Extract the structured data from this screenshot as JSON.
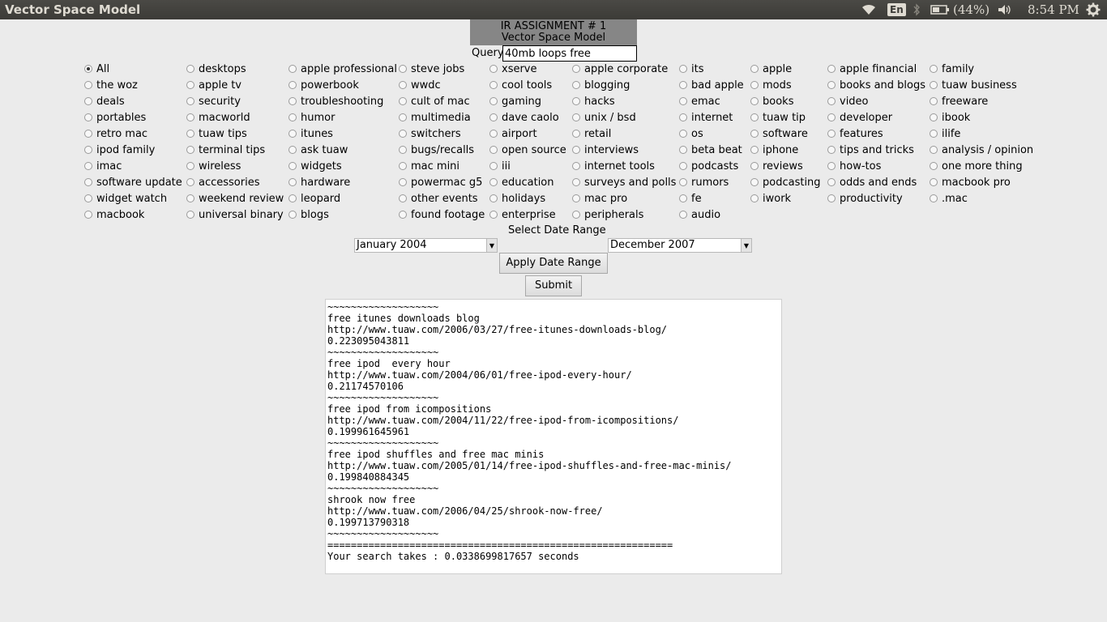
{
  "window": {
    "title": "Vector Space Model"
  },
  "tray": {
    "language": "En",
    "battery": "(44%)",
    "time": "8:54 PM"
  },
  "header": {
    "line1": "IR ASSIGNMENT # 1",
    "line2": "Vector Space Model"
  },
  "query": {
    "label": "Query",
    "value": "40mb loops free"
  },
  "categories": [
    [
      "All",
      "the woz",
      "deals",
      "portables",
      "retro mac",
      "ipod family",
      "imac",
      "software update",
      "widget watch",
      "macbook"
    ],
    [
      "desktops",
      "apple tv",
      "security",
      "macworld",
      "tuaw tips",
      "terminal tips",
      "wireless",
      "accessories",
      "weekend review",
      "universal binary"
    ],
    [
      "apple professional",
      "powerbook",
      "troubleshooting",
      "humor",
      "itunes",
      "ask tuaw",
      "widgets",
      "hardware",
      "leopard",
      "blogs"
    ],
    [
      "steve jobs",
      "wwdc",
      "cult of mac",
      "multimedia",
      "switchers",
      "bugs/recalls",
      "mac mini",
      "powermac g5",
      "other events",
      "found footage"
    ],
    [
      "xserve",
      "cool tools",
      "gaming",
      "dave caolo",
      "airport",
      "open source",
      "iii",
      "education",
      "holidays",
      "enterprise"
    ],
    [
      "apple corporate",
      "blogging",
      "hacks",
      "unix / bsd",
      "retail",
      "interviews",
      "internet tools",
      "surveys and polls",
      "mac pro",
      "peripherals"
    ],
    [
      "its",
      "bad apple",
      "emac",
      "internet",
      "os",
      "beta beat",
      "podcasts",
      "rumors",
      "fe",
      "audio"
    ],
    [
      "apple",
      "mods",
      "books",
      "tuaw tip",
      "software",
      "iphone",
      "reviews",
      "podcasting",
      "iwork"
    ],
    [
      "apple financial",
      "books and blogs",
      "video",
      "developer",
      "features",
      "tips and tricks",
      "how-tos",
      "odds and ends",
      "productivity"
    ],
    [
      "family",
      "tuaw business",
      "freeware",
      "ibook",
      "ilife",
      "analysis / opinion",
      "one more thing",
      "macbook pro",
      ".mac"
    ]
  ],
  "selected_category": "All",
  "date_range": {
    "label": "Select Date Range",
    "start": "January 2004",
    "end": "December 2007",
    "apply_label": "Apply Date Range"
  },
  "submit_label": "Submit",
  "results": [
    "~~~~~~~~~~~~~~~~~~~",
    "free itunes downloads blog",
    "http://www.tuaw.com/2006/03/27/free-itunes-downloads-blog/",
    "0.223095043811",
    "~~~~~~~~~~~~~~~~~~~",
    "free ipod  every hour",
    "http://www.tuaw.com/2004/06/01/free-ipod-every-hour/",
    "0.21174570106",
    "~~~~~~~~~~~~~~~~~~~",
    "free ipod from icompositions",
    "http://www.tuaw.com/2004/11/22/free-ipod-from-icompositions/",
    "0.199961645961",
    "~~~~~~~~~~~~~~~~~~~",
    "free ipod shuffles and free mac minis",
    "http://www.tuaw.com/2005/01/14/free-ipod-shuffles-and-free-mac-minis/",
    "0.199840884345",
    "~~~~~~~~~~~~~~~~~~~",
    "shrook now free",
    "http://www.tuaw.com/2006/04/25/shrook-now-free/",
    "0.199713790318",
    "~~~~~~~~~~~~~~~~~~~",
    "===========================================================",
    "Your search takes : 0.0338699817657 seconds"
  ]
}
